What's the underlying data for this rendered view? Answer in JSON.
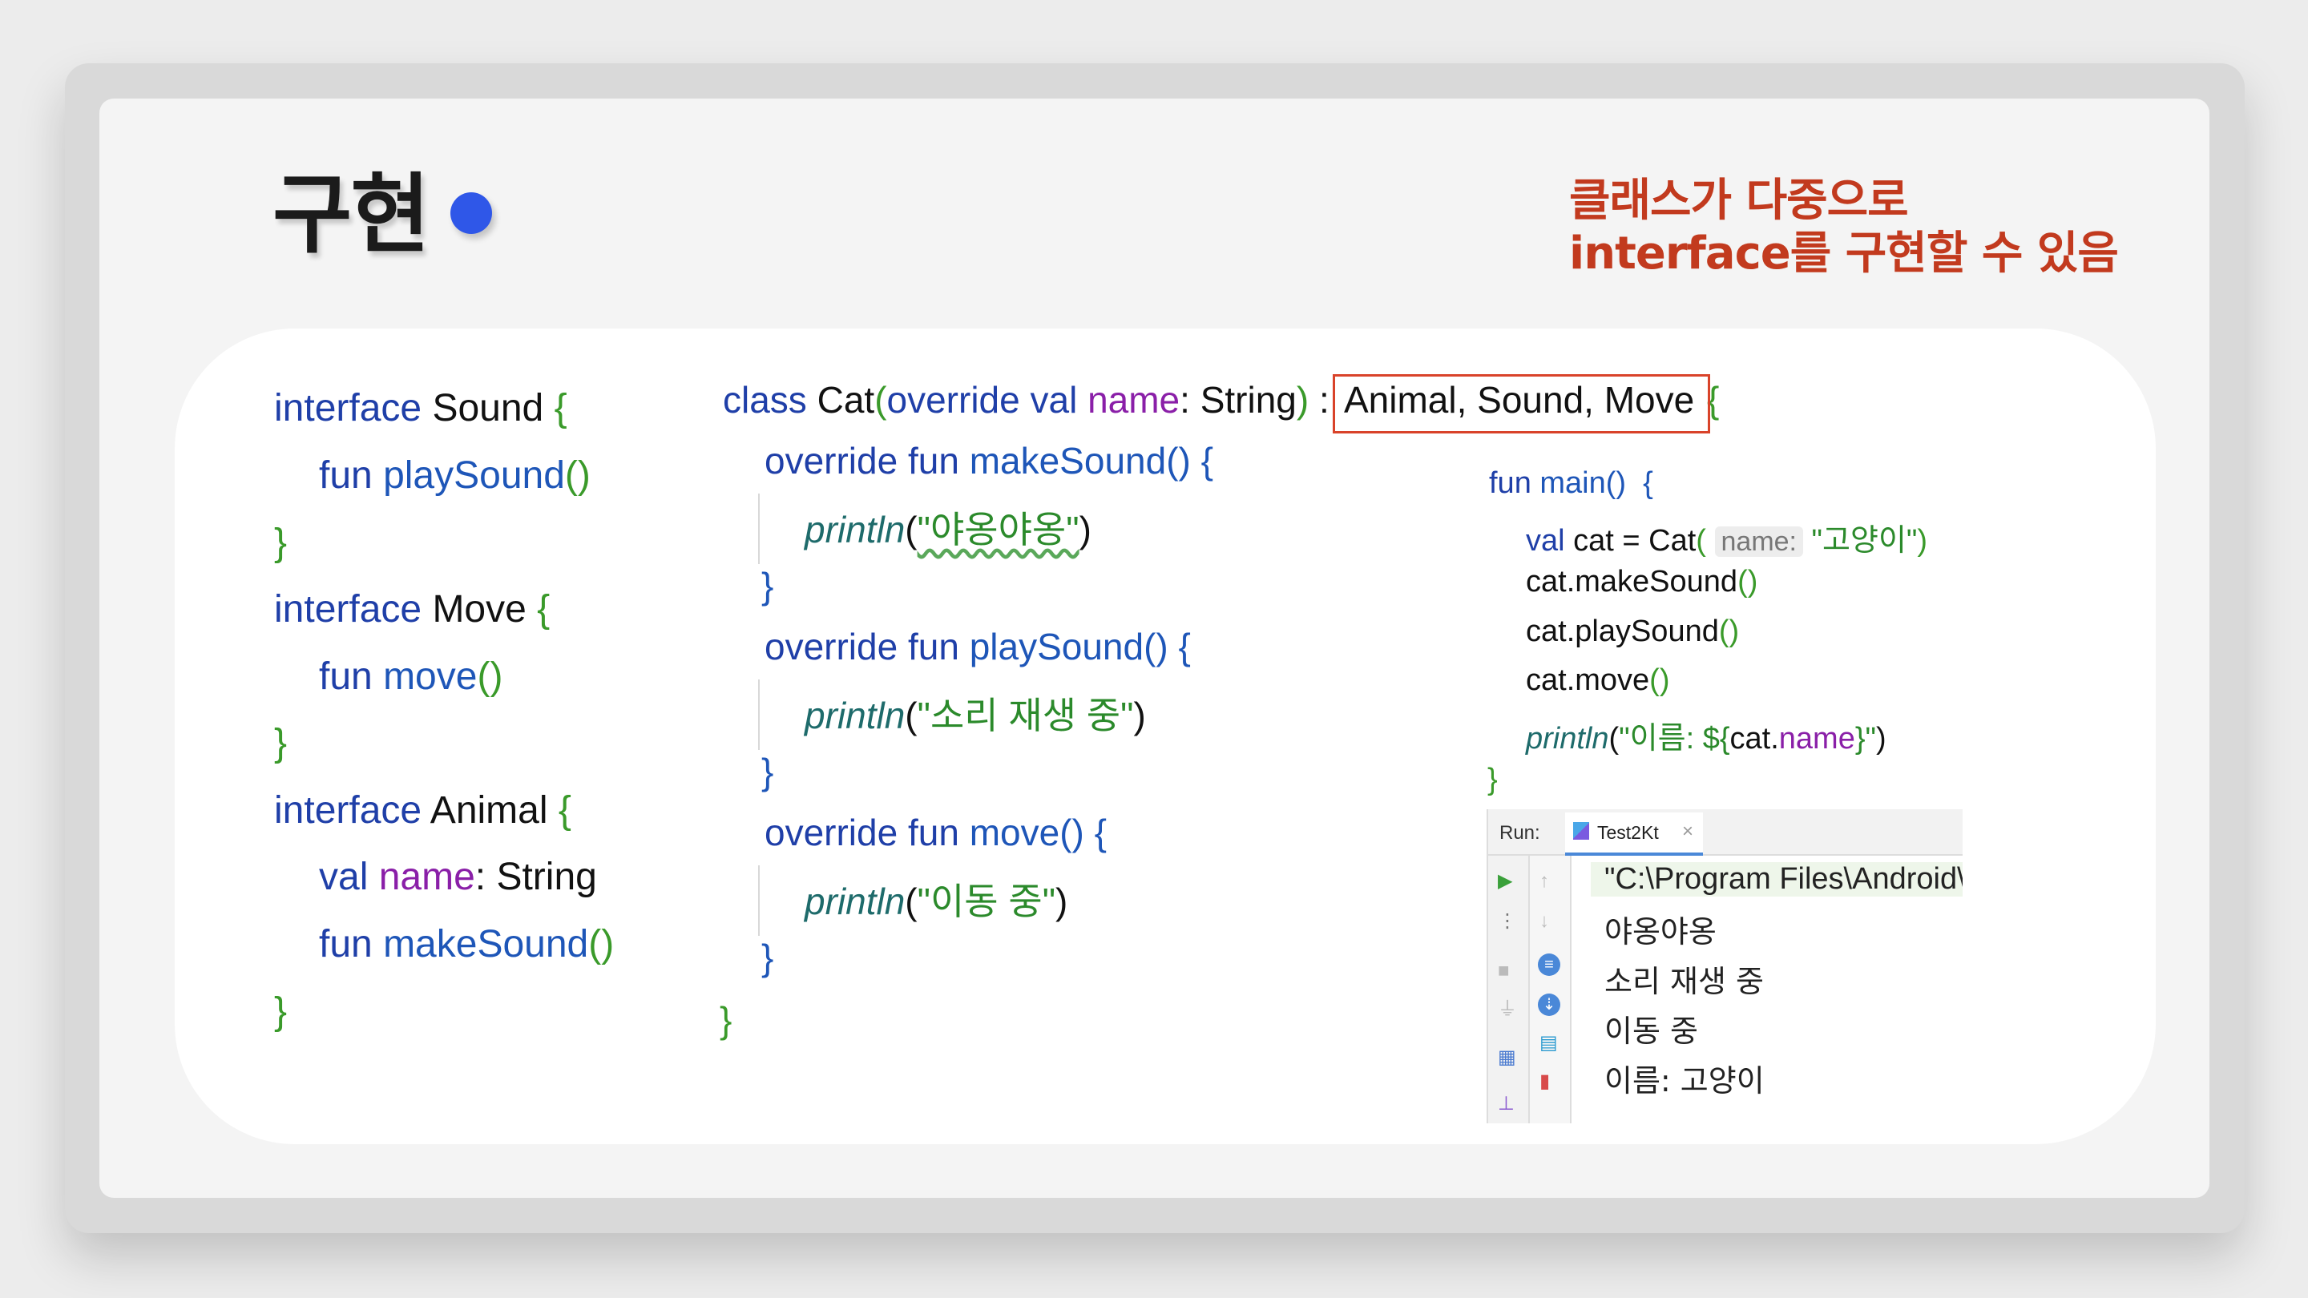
{
  "slide": {
    "title": "구현",
    "note_line1": "클래스가 다중으로",
    "note_line2": "interface를 구현할 수 있음"
  },
  "col1": {
    "l1_kw": "interface",
    "l1_name": " Sound ",
    "l1_br": "{",
    "l2_kw": "fun",
    "l2_fn": " playSound",
    "l2_br": "()",
    "l3_br": "}",
    "l4_kw": "interface",
    "l4_name": " Move ",
    "l4_br": "{",
    "l5_kw": "fun",
    "l5_fn": " move",
    "l5_br": "()",
    "l6_br": "}",
    "l7_kw": "interface",
    "l7_name": " Animal ",
    "l7_br": "{",
    "l8_kw": "val",
    "l8_prop": " name",
    "l8_rest": ": String",
    "l9_kw": "fun",
    "l9_fn": " makeSound",
    "l9_br": "()",
    "l10_br": "}"
  },
  "col2": {
    "l1_kw": "class",
    "l1_name": " Cat",
    "l1_br1": "(",
    "l1_kw2": "override val",
    "l1_prop": " name",
    "l1_rest": ": String",
    "l1_br2": ")",
    "l1_colon": " :",
    "l1_supers": "Animal, Sound, Move",
    "l1_br3": "{",
    "l2_kw": "override fun",
    "l2_fn": " makeSound",
    "l2_br": "() {",
    "l3_fn": "println",
    "l3_b1": "(",
    "l3_str": "\"야옹야옹\"",
    "l3_b2": ")",
    "l4_br": "}",
    "l5_kw": "override fun",
    "l5_fn": " playSound",
    "l5_br": "() {",
    "l6_fn": "println",
    "l6_b1": "(",
    "l6_str": "\"소리 재생 중\"",
    "l6_b2": ")",
    "l7_br": "}",
    "l8_kw": "override fun",
    "l8_fn": " move",
    "l8_br": "() {",
    "l9_fn": "println",
    "l9_b1": "(",
    "l9_str": "\"이동 중\"",
    "l9_b2": ")",
    "l10_br": "}",
    "l11_br": "}"
  },
  "col3": {
    "l1_kw": "fun",
    "l1_fn": " main",
    "l1_br": "()  {",
    "l2_kw": "val",
    "l2_rest": " cat = Cat",
    "l2_b1": "(",
    "l2_hint": "name:",
    "l2_str": " \"고양이\"",
    "l2_b2": ")",
    "l3_txt": "cat.makeSound",
    "l3_br": "()",
    "l4_txt": "cat.playSound",
    "l4_br": "()",
    "l5_txt": "cat.move",
    "l5_br": "()",
    "l6_fn": "println",
    "l6_b1": "(",
    "l6_str": "\"이름: ",
    "l6_tpl1": "${",
    "l6_expr": "cat.",
    "l6_prop": "name",
    "l6_tpl2": "}",
    "l6_str2": "\"",
    "l6_b2": ")",
    "l7_br": "}"
  },
  "run": {
    "label": "Run:",
    "tab": "Test2Kt",
    "tab_close": "×",
    "output": [
      "\"C:\\Program Files\\Android\\",
      "야옹야옹",
      "소리 재생 중",
      "이동 중",
      "이름: 고양이"
    ]
  },
  "colors": {
    "accent_red": "#c23a1e",
    "title_dot": "#2f57e8",
    "keyword": "#1f3fa8",
    "brace": "#3a9a2a",
    "property": "#8a1fa8"
  }
}
